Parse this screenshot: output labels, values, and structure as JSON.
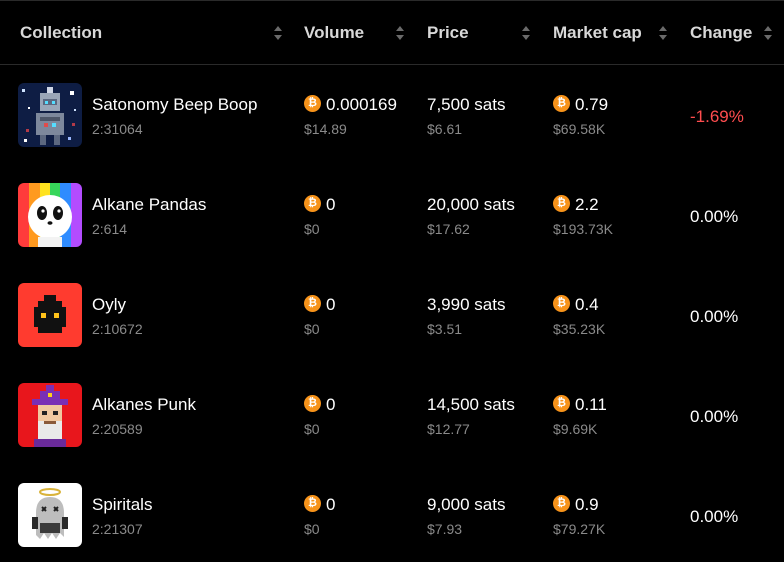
{
  "header": {
    "collection": "Collection",
    "volume": "Volume",
    "price": "Price",
    "market_cap": "Market cap",
    "change": "Change"
  },
  "colors": {
    "background": "#000000",
    "negative": "#ff4d4f",
    "neutral": "#ffffff",
    "coin": "#f7931a",
    "muted": "#8a8a8a"
  },
  "coin_icon": {
    "name": "bitcoin-icon",
    "glyph": "₿"
  },
  "rows": [
    {
      "name": "Satonomy Beep Boop",
      "id": "2:31064",
      "volume": "0.000169",
      "volume_usd": "$14.89",
      "price": "7,500 sats",
      "price_usd": "$6.61",
      "market_cap": "0.79",
      "market_cap_usd": "$69.58K",
      "change": "-1.69%",
      "change_color": "#ff4d4f"
    },
    {
      "name": "Alkane Pandas",
      "id": "2:614",
      "volume": "0",
      "volume_usd": "$0",
      "price": "20,000 sats",
      "price_usd": "$17.62",
      "market_cap": "2.2",
      "market_cap_usd": "$193.73K",
      "change": "0.00%",
      "change_color": "#ffffff"
    },
    {
      "name": "Oyly",
      "id": "2:10672",
      "volume": "0",
      "volume_usd": "$0",
      "price": "3,990 sats",
      "price_usd": "$3.51",
      "market_cap": "0.4",
      "market_cap_usd": "$35.23K",
      "change": "0.00%",
      "change_color": "#ffffff"
    },
    {
      "name": "Alkanes Punk",
      "id": "2:20589",
      "volume": "0",
      "volume_usd": "$0",
      "price": "14,500 sats",
      "price_usd": "$12.77",
      "market_cap": "0.11",
      "market_cap_usd": "$9.69K",
      "change": "0.00%",
      "change_color": "#ffffff"
    },
    {
      "name": "Spiritals",
      "id": "2:21307",
      "volume": "0",
      "volume_usd": "$0",
      "price": "9,000 sats",
      "price_usd": "$7.93",
      "market_cap": "0.9",
      "market_cap_usd": "$79.27K",
      "change": "0.00%",
      "change_color": "#ffffff"
    }
  ]
}
